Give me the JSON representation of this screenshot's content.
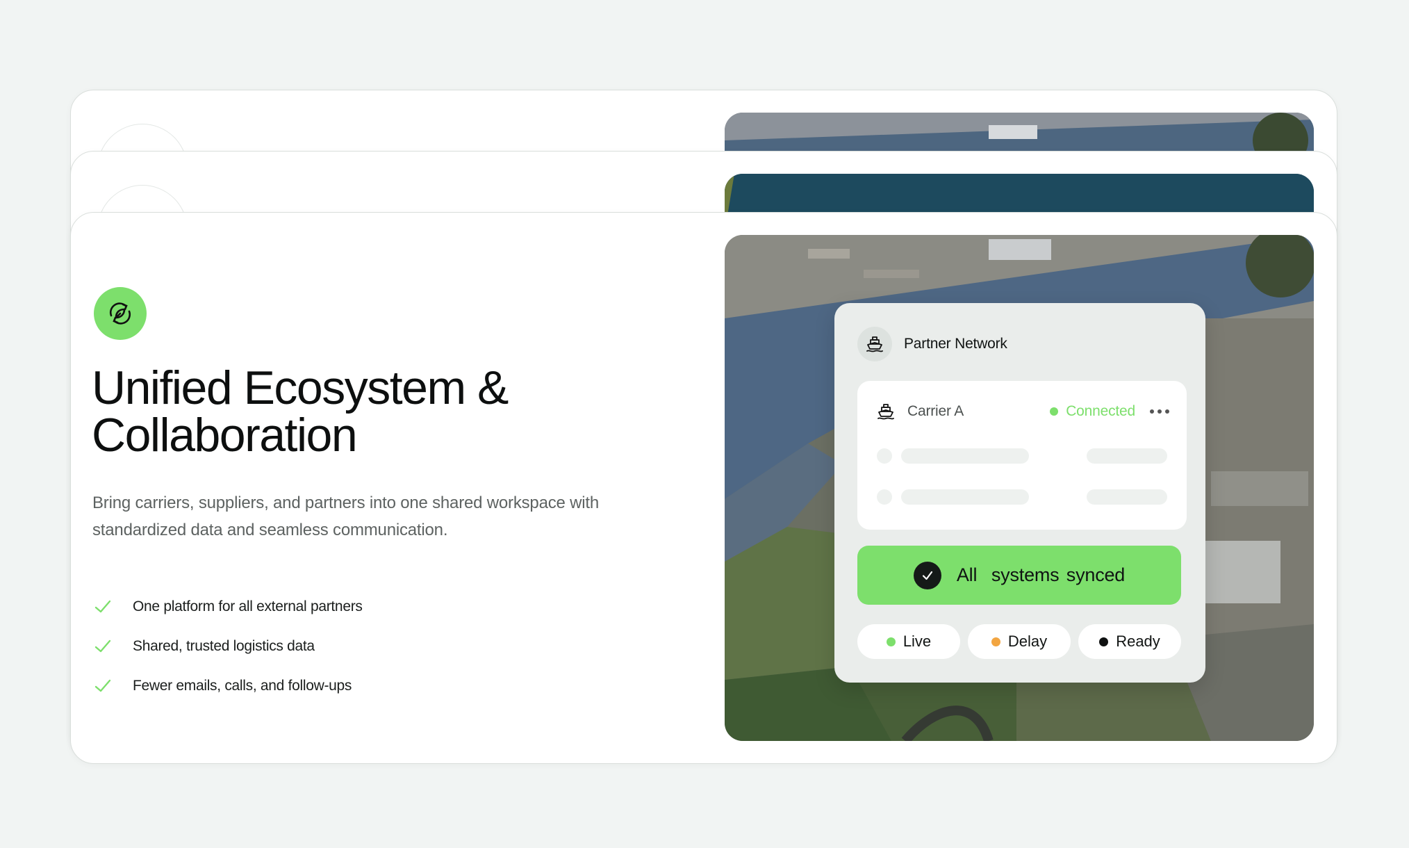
{
  "feature": {
    "title_line1": "Unified Ecosystem &",
    "title_line2": "Collaboration",
    "description_line1": "Bring carriers, suppliers, and partners into one shared workspace with",
    "description_line2": "standardized data and seamless communication.",
    "icon": "sync-leaf-icon",
    "benefits": [
      "One platform for all external partners",
      "Shared, trusted logistics data",
      "Fewer emails, calls, and follow-ups"
    ]
  },
  "panel": {
    "title": "Partner Network",
    "icon": "ship-icon",
    "carrier": {
      "name": "Carrier A",
      "status": "Connected",
      "more_icon": "more-horizontal-icon"
    },
    "sync_label": "All  systems synced",
    "statuses": [
      {
        "label": "Live",
        "color": "#7ddf6c"
      },
      {
        "label": "Delay",
        "color": "#f2a541"
      },
      {
        "label": "Ready",
        "color": "#0f1111"
      }
    ]
  },
  "colors": {
    "accent": "#7ddf6c",
    "background": "#f1f4f3",
    "text": "#0d0f0f"
  }
}
